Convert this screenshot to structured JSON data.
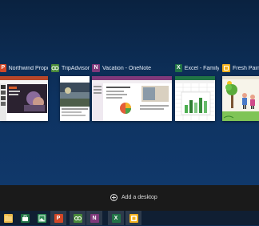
{
  "windows": [
    {
      "title": "Northwind Proposa...",
      "icon": "powerpoint-icon",
      "icon_glyph": "P",
      "color": "#d24726"
    },
    {
      "title": "TripAdvisor...",
      "icon": "tripadvisor-icon",
      "icon_glyph": "",
      "color": "#4a8a3a"
    },
    {
      "title": "Vacation - OneNote",
      "icon": "onenote-icon",
      "icon_glyph": "N",
      "color": "#80397b"
    },
    {
      "title": "Excel - Family...",
      "icon": "excel-icon",
      "icon_glyph": "X",
      "color": "#217346"
    },
    {
      "title": "Fresh Paint",
      "icon": "fresh-paint-icon",
      "icon_glyph": "",
      "color": "#f2b01e"
    }
  ],
  "task_view": {
    "add_desktop_label": "Add a desktop"
  },
  "taskbar": {
    "items": [
      {
        "name": "file-explorer-icon",
        "glyph": "",
        "color": "#e8b84a"
      },
      {
        "name": "store-icon",
        "glyph": "",
        "color": "#217346"
      },
      {
        "name": "photos-icon",
        "glyph": "",
        "color": "#2b8a52"
      },
      {
        "name": "powerpoint-icon",
        "glyph": "P",
        "color": "#d24726"
      },
      {
        "name": "tripadvisor-icon",
        "glyph": "",
        "color": "#4a8a3a"
      },
      {
        "name": "onenote-icon",
        "glyph": "N",
        "color": "#80397b"
      },
      {
        "name": "excel-icon",
        "glyph": "X",
        "color": "#217346"
      },
      {
        "name": "fresh-paint-icon",
        "glyph": "",
        "color": "#f2b01e"
      }
    ]
  }
}
